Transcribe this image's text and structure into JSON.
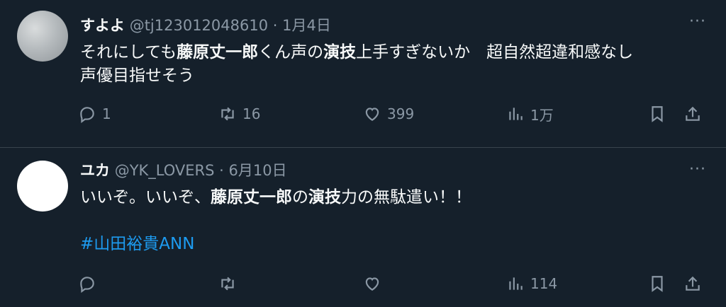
{
  "tweets": [
    {
      "name": "すよよ",
      "handle": "@tj123012048610",
      "sep": "·",
      "date": "1月4日",
      "more": "···",
      "text": {
        "p1": "それにしても",
        "b1": "藤原丈一郎",
        "p2": "くん声の",
        "b2": "演技",
        "p3": "上手すぎないか　超自然超違和感なし",
        "line2": "声優目指せそう"
      },
      "stats": {
        "replies": "1",
        "retweets": "16",
        "likes": "399",
        "views": "1万"
      }
    },
    {
      "name": "ユカ",
      "handle": "@YK_LOVERS",
      "sep": "·",
      "date": "6月10日",
      "more": "···",
      "text": {
        "p1": "いいぞ。いいぞ、",
        "b1": "藤原丈一郎",
        "p2": "の",
        "b2": "演技",
        "p3": "力の無駄遣い！！",
        "hashtag": "#山田裕貴ANN"
      },
      "stats": {
        "replies": "",
        "retweets": "",
        "likes": "",
        "views": "114"
      }
    }
  ],
  "icons": [
    "reply-icon",
    "retweet-icon",
    "like-icon",
    "views-icon",
    "bookmark-icon",
    "share-icon"
  ],
  "colors": {
    "background": "#15202b",
    "text": "#f7f9f9",
    "muted": "#8b98a5",
    "link": "#1d9bf0",
    "divider": "#38444d"
  }
}
